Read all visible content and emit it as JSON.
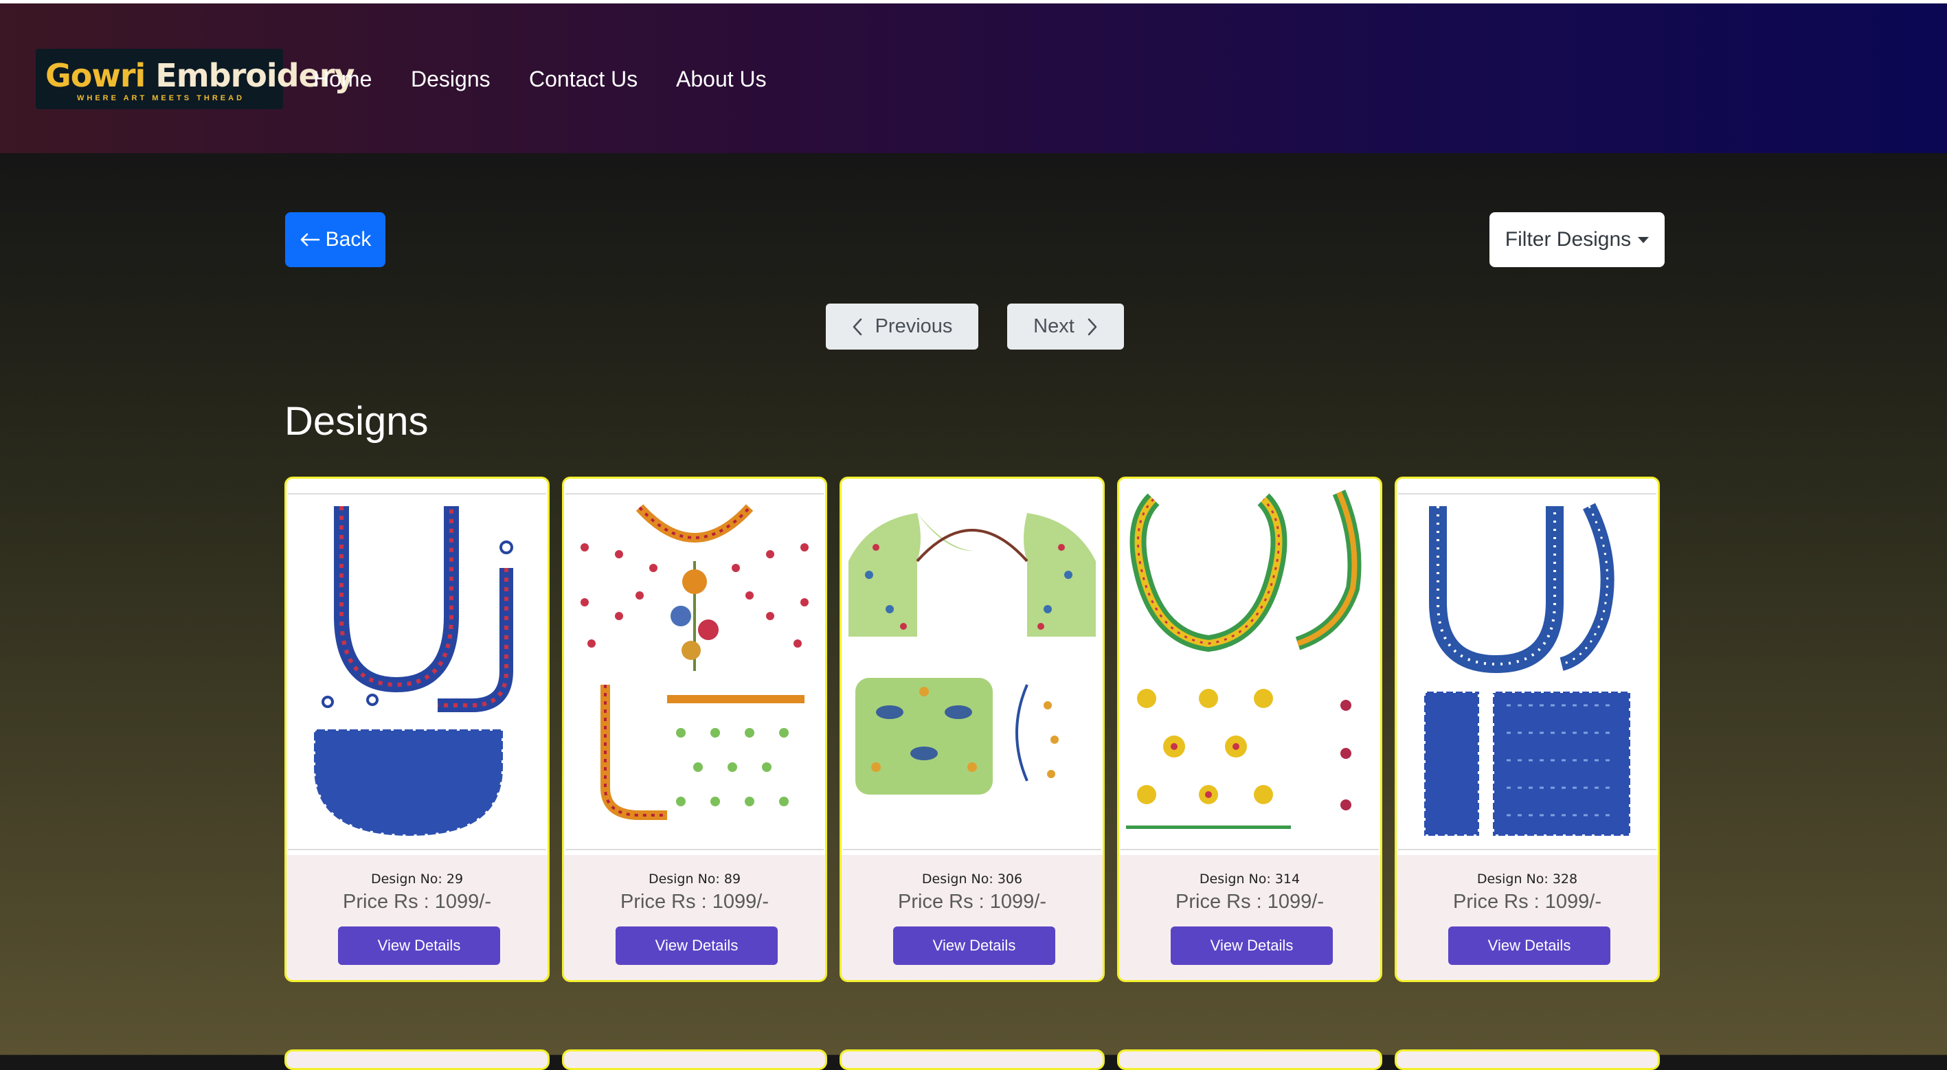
{
  "brand": {
    "name_part1": "Gowri",
    "name_part2": "Embroidery",
    "tagline": "WHERE ART MEETS THREAD"
  },
  "nav": {
    "links": [
      "Home",
      "Designs",
      "Contact Us",
      "About Us"
    ]
  },
  "actions": {
    "back_label": "Back",
    "filter_label": "Filter Designs"
  },
  "pagination": {
    "previous_label": "Previous",
    "next_label": "Next"
  },
  "section": {
    "title": "Designs"
  },
  "designs": [
    {
      "design_no": "Design No: 29",
      "price": "Price Rs : 1099/-",
      "button": "View Details"
    },
    {
      "design_no": "Design No: 89",
      "price": "Price Rs : 1099/-",
      "button": "View Details"
    },
    {
      "design_no": "Design No: 306",
      "price": "Price Rs : 1099/-",
      "button": "View Details"
    },
    {
      "design_no": "Design No: 314",
      "price": "Price Rs : 1099/-",
      "button": "View Details"
    },
    {
      "design_no": "Design No: 328",
      "price": "Price Rs : 1099/-",
      "button": "View Details"
    }
  ],
  "colors": {
    "primary_button": "#0d6efd",
    "view_button": "#5a44c6",
    "card_border": "#f2f02c",
    "logo_gold": "#f1bb2f"
  },
  "icons": [
    "arrow-left-icon",
    "caret-down-icon",
    "chevron-left-icon",
    "chevron-right-icon"
  ]
}
